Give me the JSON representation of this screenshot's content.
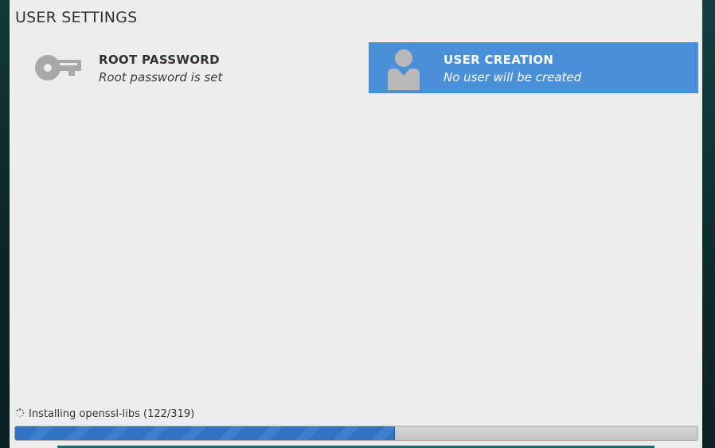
{
  "header": {
    "title": "USER SETTINGS"
  },
  "spokes": [
    {
      "id": "root-password",
      "icon": "key-icon",
      "title": "ROOT PASSWORD",
      "status": "Root password is set",
      "selected": false
    },
    {
      "id": "user-creation",
      "icon": "user-icon",
      "title": "USER CREATION",
      "status": "No user will be created",
      "selected": true
    }
  ],
  "progress": {
    "label": "Installing openssl-libs (122/319)",
    "current": 122,
    "total": 319,
    "fraction": 0.556,
    "spinner_icon": "spinner-icon"
  },
  "colors": {
    "panel_background": "#ededed",
    "selected_spoke": "#4a90d9",
    "progress_fill": "#2f74c4",
    "icon_gray": "#a8a8a8"
  }
}
